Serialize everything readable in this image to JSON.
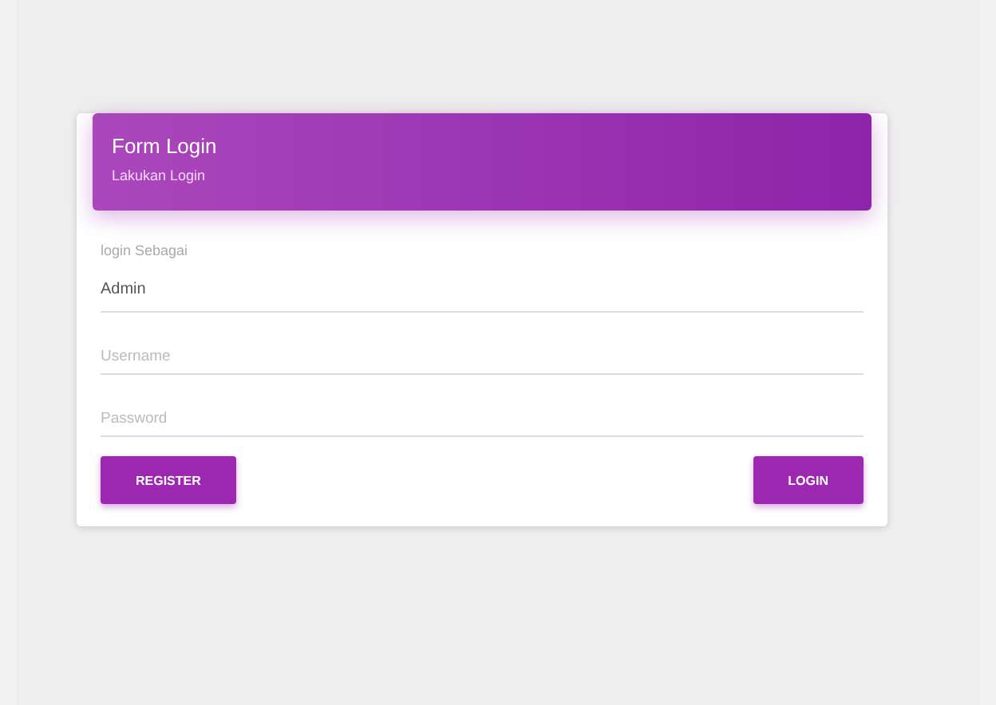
{
  "card_header": {
    "title": "Form Login",
    "subtitle": "Lakukan Login"
  },
  "fields": [
    {
      "kind": "select",
      "label": "login Sebagai",
      "value": "Admin"
    },
    {
      "kind": "input",
      "placeholder": "Username"
    },
    {
      "kind": "input",
      "placeholder": "Password"
    }
  ],
  "buttons": [
    "REGISTER",
    "LOGIN"
  ]
}
